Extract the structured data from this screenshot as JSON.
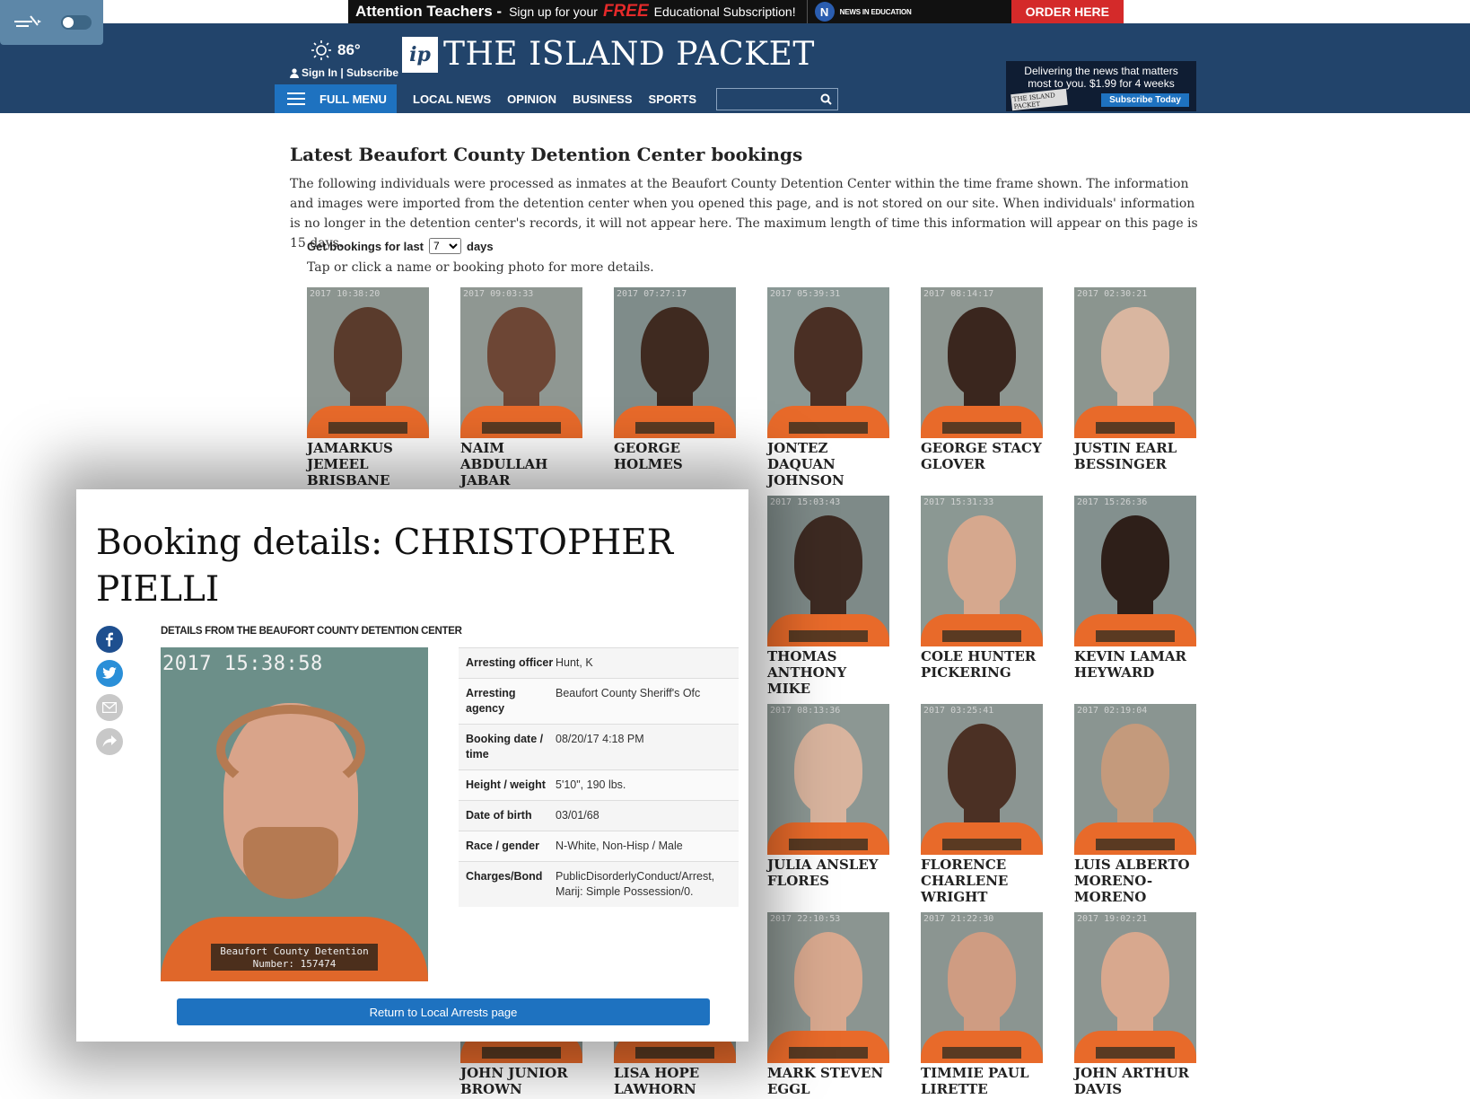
{
  "ad_banner": {
    "headline": "Attention Teachers -",
    "sub1": "Sign up for your",
    "free": "FREE",
    "sub2": "Educational Subscription!",
    "partner": "NEWS IN EDUCATION",
    "cta": "ORDER HERE"
  },
  "header": {
    "temperature": "86°",
    "signin": "Sign In | Subscribe",
    "logo_mark": "ip",
    "logo_text": "THE ISLAND PACKET",
    "menu_label": "FULL MENU",
    "nav": [
      "LOCAL NEWS",
      "OPINION",
      "BUSINESS",
      "SPORTS"
    ],
    "search_placeholder": "",
    "promo_line1": "Delivering the news that matters",
    "promo_line2": "most to you. $1.99 for 4 weeks",
    "promo_paper": "THE ISLAND PACKET",
    "promo_button": "Subscribe Today"
  },
  "article": {
    "title": "Latest Beaufort County Detention Center bookings",
    "intro": "The following individuals were processed as inmates at the Beaufort County Detention Center within the time frame shown. The information and images were imported from the detention center when you opened this page, and is not stored on our site. When individuals' information is no longer in the detention center's records, it will not appear here. The maximum length of time this information will appear on this page is 15 days.",
    "filter_prefix": "Get bookings for last",
    "filter_value": "7",
    "filter_suffix": "days",
    "tap_hint": "Tap or click a name or booking photo for more details."
  },
  "bookings": [
    {
      "name": "JAMARKUS JEMEEL BRISBANE",
      "ts": "2017 10:38:20",
      "skin": "#5a3b2c",
      "bg": "#8c9590"
    },
    {
      "name": "NAIM ABDULLAH JABAR",
      "ts": "2017 09:03:33",
      "skin": "#6d4635",
      "bg": "#8f9792"
    },
    {
      "name": "GEORGE HOLMES",
      "ts": "2017 07:27:17",
      "skin": "#3f2a20",
      "bg": "#7f8c8a"
    },
    {
      "name": "JONTEZ DAQUAN JOHNSON",
      "ts": "2017 05:39:31",
      "skin": "#4a2f24",
      "bg": "#8a9895"
    },
    {
      "name": "GEORGE STACY GLOVER",
      "ts": "2017 08:14:17",
      "skin": "#3a261e",
      "bg": "#8d9691"
    },
    {
      "name": "JUSTIN EARL BESSINGER",
      "ts": "2017 02:30:21",
      "skin": "#d9b6a0",
      "bg": "#8b958f"
    },
    {
      "name": "THOMAS ANTHONY MIKE",
      "ts": "2017 15:03:43",
      "skin": "#3d2a22",
      "bg": "#7e8a88"
    },
    {
      "name": "COLE HUNTER PICKERING",
      "ts": "2017 15:31:33",
      "skin": "#d6a88e",
      "bg": "#8b9893"
    },
    {
      "name": "KEVIN LAMAR HEYWARD",
      "ts": "2017 15:26:36",
      "skin": "#2e1f19",
      "bg": "#83908e"
    },
    {
      "name": "JULIA ANSLEY FLORES",
      "ts": "2017 08:13:36",
      "skin": "#d9b49e",
      "bg": "#8c9793"
    },
    {
      "name": "FLORENCE CHARLENE WRIGHT",
      "ts": "2017 03:25:41",
      "skin": "#4b3024",
      "bg": "#8b9592"
    },
    {
      "name": "LUIS ALBERTO MORENO-MORENO",
      "ts": "2017 02:19:04",
      "skin": "#c49a7c",
      "bg": "#8a9591"
    },
    {
      "name": "JOHN JUNIOR BROWN",
      "ts": "",
      "skin": "#8c6248",
      "bg": "#8a9591"
    },
    {
      "name": "LISA HOPE LAWHORN",
      "ts": "",
      "skin": "#d8b09a",
      "bg": "#8a9591"
    },
    {
      "name": "MARK STEVEN EGGL",
      "ts": "2017 22:10:53",
      "skin": "#d9a98f",
      "bg": "#8b9591"
    },
    {
      "name": "TIMMIE PAUL LIRETTE",
      "ts": "2017 21:22:30",
      "skin": "#cf9c82",
      "bg": "#8b9591"
    },
    {
      "name": "JOHN ARTHUR DAVIS",
      "ts": "2017 19:02:21",
      "skin": "#d8a88e",
      "bg": "#8b9591"
    }
  ],
  "modal": {
    "title": "Booking details: CHRISTOPHER PIELLI",
    "source": "DETAILS FROM THE BEAUFORT COUNTY DETENTION CENTER",
    "photo_timestamp": "2017 15:38:58",
    "plate_line1": "Beaufort County Detention",
    "plate_line2": "Number: 157474",
    "rows": [
      {
        "label": "Arresting officer",
        "value": "Hunt, K"
      },
      {
        "label": "Arresting agency",
        "value": "Beaufort County Sheriff's Ofc"
      },
      {
        "label": "Booking date / time",
        "value": "08/20/17 4:18 PM"
      },
      {
        "label": "Height / weight",
        "value": "5'10\", 190 lbs."
      },
      {
        "label": "Date of birth",
        "value": "03/01/68"
      },
      {
        "label": "Race / gender",
        "value": "N-White, Non-Hisp / Male"
      },
      {
        "label": "Charges/Bond",
        "value": "PublicDisorderlyConduct/Arrest, Marij: Simple Possession/0."
      }
    ],
    "return_label": "Return to Local Arrests page"
  },
  "colors": {
    "header_bg": "#22446b",
    "accent": "#1e72c0",
    "jumpsuit": "#e86a2a"
  }
}
